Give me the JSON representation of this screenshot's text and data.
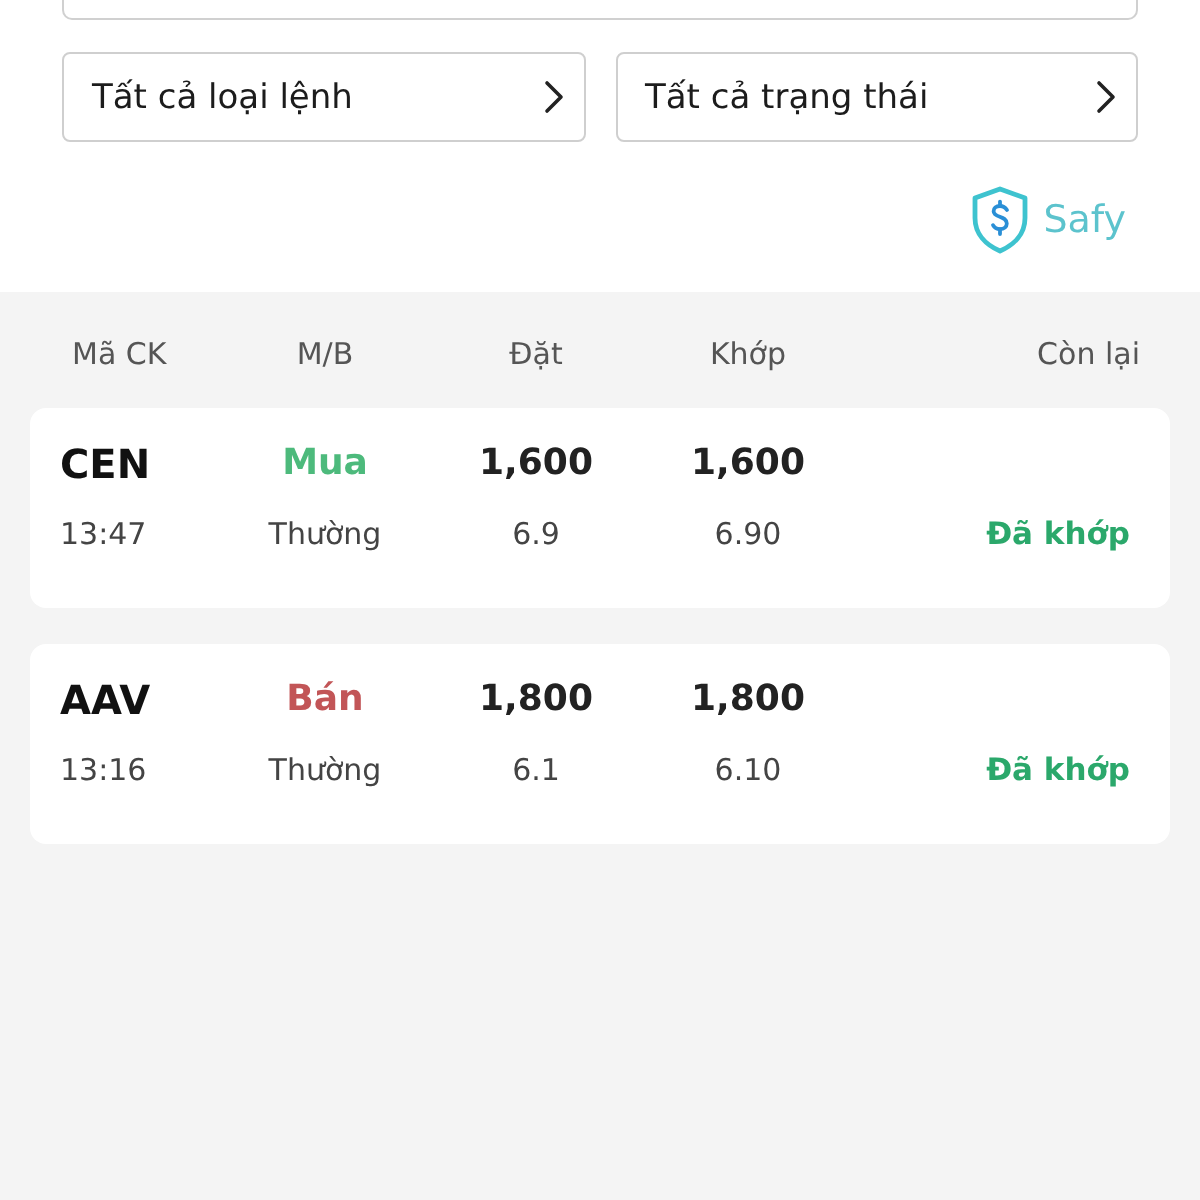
{
  "filters": [
    {
      "label": "Tất cả loại lệnh"
    },
    {
      "label": "Tất cả trạng thái"
    }
  ],
  "brand": {
    "name": "Safy"
  },
  "table": {
    "columns": [
      "Mã CK",
      "M/B",
      "Đặt",
      "Khớp",
      "Còn lại"
    ],
    "rows": [
      {
        "symbol": "CEN",
        "side": {
          "label": "Mua",
          "color": "#4dba7c"
        },
        "order_qty": "1,600",
        "matched_qty": "1,600",
        "time": "13:47",
        "order_type": "Thường",
        "order_price": "6.9",
        "matched_price": "6.90",
        "status": "Đã khớp"
      },
      {
        "symbol": "AAV",
        "side": {
          "label": "Bán",
          "color": "#c25557"
        },
        "order_qty": "1,800",
        "matched_qty": "1,800",
        "time": "13:16",
        "order_type": "Thường",
        "order_price": "6.1",
        "matched_price": "6.10",
        "status": "Đã khớp"
      }
    ]
  }
}
